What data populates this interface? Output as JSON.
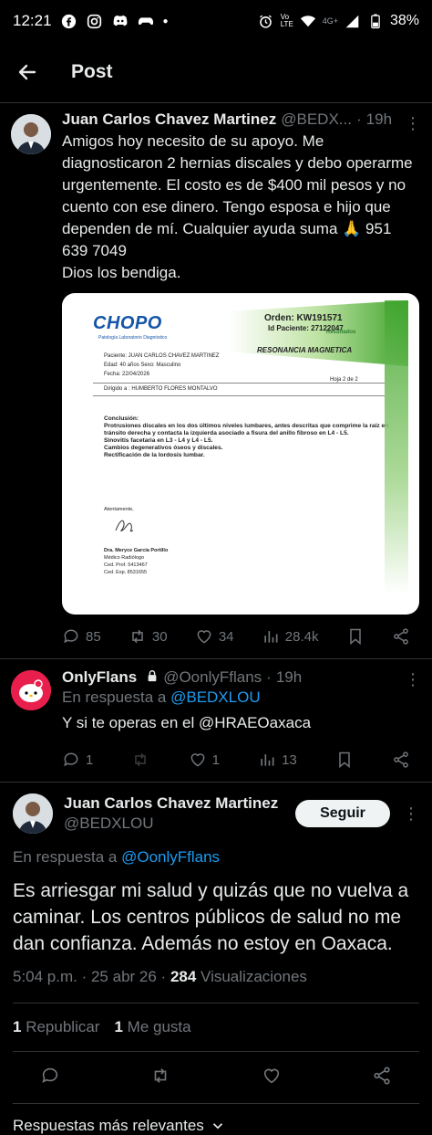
{
  "status_bar": {
    "time": "12:21",
    "network": "4G+",
    "volte": "Vo LTE",
    "battery": "38%"
  },
  "header": {
    "title": "Post"
  },
  "tweet1": {
    "name": "Juan Carlos Chavez Martinez",
    "handle": "@BEDX...",
    "dot": "·",
    "time": "19h",
    "text": "Amigos hoy necesito de su apoyo. Me diagnosticaron 2 hernias discales y debo operarme urgentemente. El costo es de $400 mil pesos y no cuento con ese dinero. Tengo esposa e hijo que dependen de mí. Cualquier ayuda suma 🙏 951 639 7049\nDios los bendiga.",
    "media": {
      "logo": "CHOPO",
      "logo_sub": "Patología Laboratorio Diagnóstico",
      "orden_label": "Orden: KW191571",
      "id_paciente": "Id Paciente: 27122047",
      "resultados": "Resultados",
      "study": "RESONANCIA MAGNETICA",
      "paciente": "Paciente:   JUAN CARLOS CHAVEZ MARTINEZ",
      "edad": "Edad:   40 años     Sexo:   Masculino",
      "fecha": "Fecha:         22/04/2026",
      "hoja": "Hoja 2 de 2",
      "dirigido": "Dirigido a :   HUMBERTO FLORES MONTALVO",
      "conclusion_title": "Conclusión:",
      "conclusion": "Protrusiones discales en los dos últimos niveles lumbares, antes descritas que comprime la raíz en tránsito derecha y contacta la izquierda asociado a fisura del anillo fibroso en L4 - L5.\nSinovitis facetaria en L3 - L4 y L4 - L5.\nCambios degenerativos óseos y discales.\nRectificación de la lordosis lumbar.",
      "atentamente": "Atentamente,",
      "doctor": "Dra. Meryce García Portillo",
      "doctor_role": "Médico Radiólogo",
      "ced_prof": "Ced. Prof. 5413467",
      "ced_esp": "Ced. Esp. 8531655"
    },
    "stats": {
      "replies": "85",
      "reposts": "30",
      "likes": "34",
      "views": "28.4k"
    }
  },
  "tweet2": {
    "name": "OnlyFlans",
    "handle": "@OonlyFflans",
    "dot": "·",
    "time": "19h",
    "reply_prefix": "En respuesta a",
    "reply_handle": "@BEDXLOU",
    "text": "Y si te operas en el @HRAEOaxaca",
    "stats": {
      "replies": "1",
      "likes": "1",
      "views": "13"
    }
  },
  "main_tweet": {
    "name": "Juan Carlos Chavez Martinez",
    "handle": "@BEDXLOU",
    "follow_label": "Seguir",
    "reply_prefix": "En respuesta a",
    "reply_handle": "@OonlyFflans",
    "text": "Es arriesgar mi salud y quizás que no vuelva a caminar. Los centros públicos de salud no me dan confianza. Además no estoy en Oaxaca.",
    "time": "5:04 p.m. · 25 abr 26 ·",
    "views_count": "284",
    "views_label": "Visualizaciones",
    "reposts_count": "1",
    "reposts_label": "Republicar",
    "likes_count": "1",
    "likes_label": "Me gusta"
  },
  "sort": {
    "label": "Respuestas más relevantes"
  },
  "colors": {
    "accent": "#1d9bf0",
    "background": "#000000",
    "muted": "#71767b",
    "chopo_green": "#3fa42d",
    "chopo_blue": "#1556a8"
  }
}
